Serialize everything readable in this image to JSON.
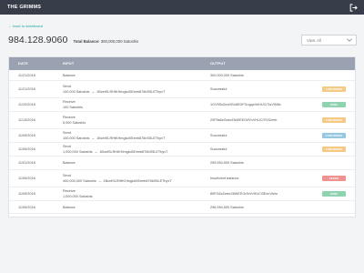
{
  "app": {
    "title": "THE GRIMMS"
  },
  "icons": {
    "logout": "logout-icon",
    "chevron": "chevron-down-icon",
    "arrow": "right-arrow"
  },
  "nav": {
    "back_label": "← back to dashboard"
  },
  "summary": {
    "balance": "984.128.9060",
    "total_label": "Total Balance:",
    "total_value": "300,000,000 Satoshis"
  },
  "filter": {
    "selected": "View: All"
  },
  "table": {
    "headers": {
      "date": "DATE",
      "input": "INPUT",
      "output": "OUTPUT"
    },
    "rows": [
      {
        "date": "11/21/2018",
        "input1": "Balance",
        "input2": "",
        "addr": "",
        "output": "300,000,000 Satoshis",
        "status": ""
      },
      {
        "date": "11/21/2018",
        "input1": "Send",
        "input2": "100,000 Satoshis",
        "addr": "1BcetSLRHtKHmgkdXEeeb876bS5LETbyvT",
        "output": "Successful",
        "status": "pending"
      },
      {
        "date": "11/20/2018",
        "input1": "Receive",
        "input2": "100 Satoshis",
        "addr": "",
        "output": "1GV9Sx2mz5Sv6EDFGngqxVeHUCi7IsVS6tb",
        "status": "ok"
      },
      {
        "date": "11/13/2018",
        "input1": "Receive",
        "input2": "5,000 Satoshis",
        "addr": "",
        "output": "20F9s6eZwecDkWEEGrfVxVHUCi7iVi2rmb",
        "status": "pending"
      },
      {
        "date": "11/09/2018",
        "input1": "Send",
        "input2": "100,000 Satoshis",
        "addr": "1BcetSLRHtKHmgkdXEeeb876bS5LETbyvT",
        "output": "Successful",
        "status": "info"
      },
      {
        "date": "11/09/2018",
        "input1": "Send",
        "input2": "1,000,000 Satoshis",
        "addr": "1BcetSLRHtKHmgkdXEeeb876bS5LETbyvT",
        "output": "Successful",
        "status": "pending"
      },
      {
        "date": "11/01/2018",
        "input1": "Balance",
        "input2": "",
        "addr": "",
        "output": "299,994,500 Satoshis",
        "status": ""
      },
      {
        "date": "11/09/2018",
        "input1": "Send",
        "input2": "400,000,000 Satoshis",
        "addr": "1BcetSLRHtKHmgkdXEeeb876bS5LETbyvT",
        "output": "Insuficient balance",
        "status": "error"
      },
      {
        "date": "11/09/2018",
        "input1": "Receive",
        "input2": "1,000,000 Satoshis",
        "addr": "",
        "output": "89FG6cZwec26WEEGrfVxVHUCi3EzxVAim",
        "status": "ok"
      },
      {
        "date": "11/09/2018",
        "input1": "Balance",
        "input2": "",
        "addr": "",
        "output": "298,994,500 Satoshis",
        "status": ""
      }
    ]
  },
  "badges": {
    "pending": {
      "label": "CONFIRMING",
      "color": "#f4ca86"
    },
    "ok": {
      "label": "DONE",
      "color": "#8fd3b1"
    },
    "info": {
      "label": "CONFIRMING",
      "color": "#96c8e2"
    },
    "error": {
      "label": "ERROR",
      "color": "#ee9292"
    }
  },
  "colors": {
    "topbar": "#363c48",
    "table_header": "#9aa2b1",
    "link": "#22a9a0"
  }
}
